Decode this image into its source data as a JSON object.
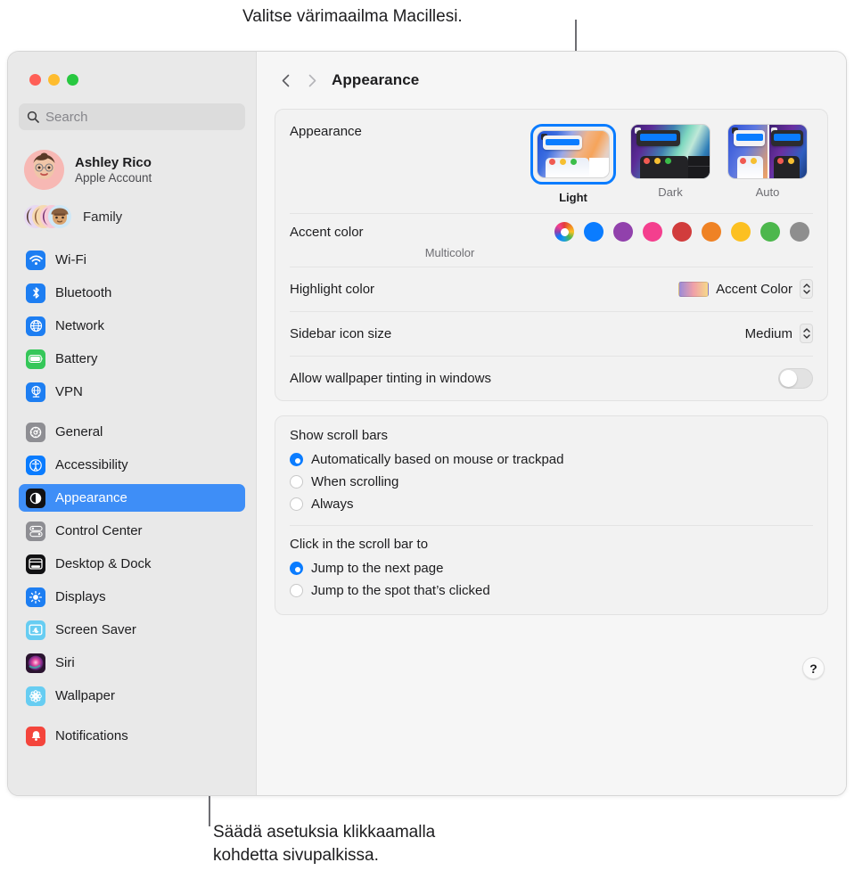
{
  "annotations": {
    "top": "Valitse värimaailma Macillesi.",
    "bottom": "Säädä asetuksia klikkaamalla\nkohdetta sivupalkissa."
  },
  "window": {
    "traffic_lights": [
      "close",
      "minimize",
      "zoom"
    ],
    "title": "Appearance",
    "nav_back_icon": "chevron-left-icon",
    "nav_forward_icon": "chevron-right-icon"
  },
  "sidebar": {
    "search": {
      "placeholder": "Search",
      "value": "",
      "icon": "search-icon"
    },
    "account": {
      "name": "Ashley Rico",
      "subtitle": "Apple Account",
      "avatar": "memoji-avatar"
    },
    "family": {
      "label": "Family",
      "icon": "family-avatars"
    },
    "groups": [
      {
        "items": [
          {
            "label": "Wi-Fi",
            "icon": "wifi-icon",
            "color": "#1d7ef2"
          },
          {
            "label": "Bluetooth",
            "icon": "bluetooth-icon",
            "color": "#1d7ef2"
          },
          {
            "label": "Network",
            "icon": "globe-icon",
            "color": "#1d7ef2"
          },
          {
            "label": "Battery",
            "icon": "battery-icon",
            "color": "#35c759"
          },
          {
            "label": "VPN",
            "icon": "vpn-globe-icon",
            "color": "#1d7ef2"
          }
        ]
      },
      {
        "items": [
          {
            "label": "General",
            "icon": "gear-icon",
            "color": "#8e8e93",
            "selected": false
          },
          {
            "label": "Accessibility",
            "icon": "accessibility-icon",
            "color": "#0a7cff",
            "selected": false
          },
          {
            "label": "Appearance",
            "icon": "appearance-icon",
            "color": "#111113",
            "selected": true
          },
          {
            "label": "Control Center",
            "icon": "control-center-icon",
            "color": "#8e8e93",
            "selected": false
          },
          {
            "label": "Desktop & Dock",
            "icon": "desktop-dock-icon",
            "color": "#111113",
            "selected": false
          },
          {
            "label": "Displays",
            "icon": "brightness-icon",
            "color": "#1d7ef2",
            "selected": false
          },
          {
            "label": "Screen Saver",
            "icon": "screen-saver-icon",
            "color": "#67cdf2",
            "selected": false
          },
          {
            "label": "Siri",
            "icon": "siri-icon",
            "color": "#2b1430",
            "selected": false
          },
          {
            "label": "Wallpaper",
            "icon": "wallpaper-icon",
            "color": "#67cdf2",
            "selected": false
          }
        ]
      },
      {
        "items": [
          {
            "label": "Notifications",
            "icon": "bell-icon",
            "color": "#f4453c",
            "selected": false
          }
        ]
      }
    ]
  },
  "main": {
    "appearance": {
      "label": "Appearance",
      "options": [
        {
          "label": "Light",
          "selected": true
        },
        {
          "label": "Dark",
          "selected": false
        },
        {
          "label": "Auto",
          "selected": false
        }
      ]
    },
    "accent_color": {
      "label": "Accent color",
      "selected_label": "Multicolor",
      "swatches": [
        {
          "name": "multicolor",
          "color": "multicolor",
          "selected": true
        },
        {
          "name": "blue",
          "color": "#0a7cff",
          "selected": false
        },
        {
          "name": "purple",
          "color": "#9141ac",
          "selected": false
        },
        {
          "name": "pink",
          "color": "#f43f8e",
          "selected": false
        },
        {
          "name": "red",
          "color": "#d13c3c",
          "selected": false
        },
        {
          "name": "orange",
          "color": "#ef8224",
          "selected": false
        },
        {
          "name": "yellow",
          "color": "#fcc021",
          "selected": false
        },
        {
          "name": "green",
          "color": "#4cb74c",
          "selected": false
        },
        {
          "name": "graphite",
          "color": "#8e8e8e",
          "selected": false
        }
      ]
    },
    "highlight_color": {
      "label": "Highlight color",
      "value": "Accent Color"
    },
    "sidebar_icon_size": {
      "label": "Sidebar icon size",
      "value": "Medium"
    },
    "wallpaper_tinting": {
      "label": "Allow wallpaper tinting in windows",
      "enabled": false
    },
    "show_scroll_bars": {
      "title": "Show scroll bars",
      "options": [
        {
          "label": "Automatically based on mouse or trackpad",
          "selected": true
        },
        {
          "label": "When scrolling",
          "selected": false
        },
        {
          "label": "Always",
          "selected": false
        }
      ]
    },
    "click_scroll_bar": {
      "title": "Click in the scroll bar to",
      "options": [
        {
          "label": "Jump to the next page",
          "selected": true
        },
        {
          "label": "Jump to the spot that’s clicked",
          "selected": false
        }
      ]
    },
    "help_button": {
      "label": "?"
    }
  }
}
